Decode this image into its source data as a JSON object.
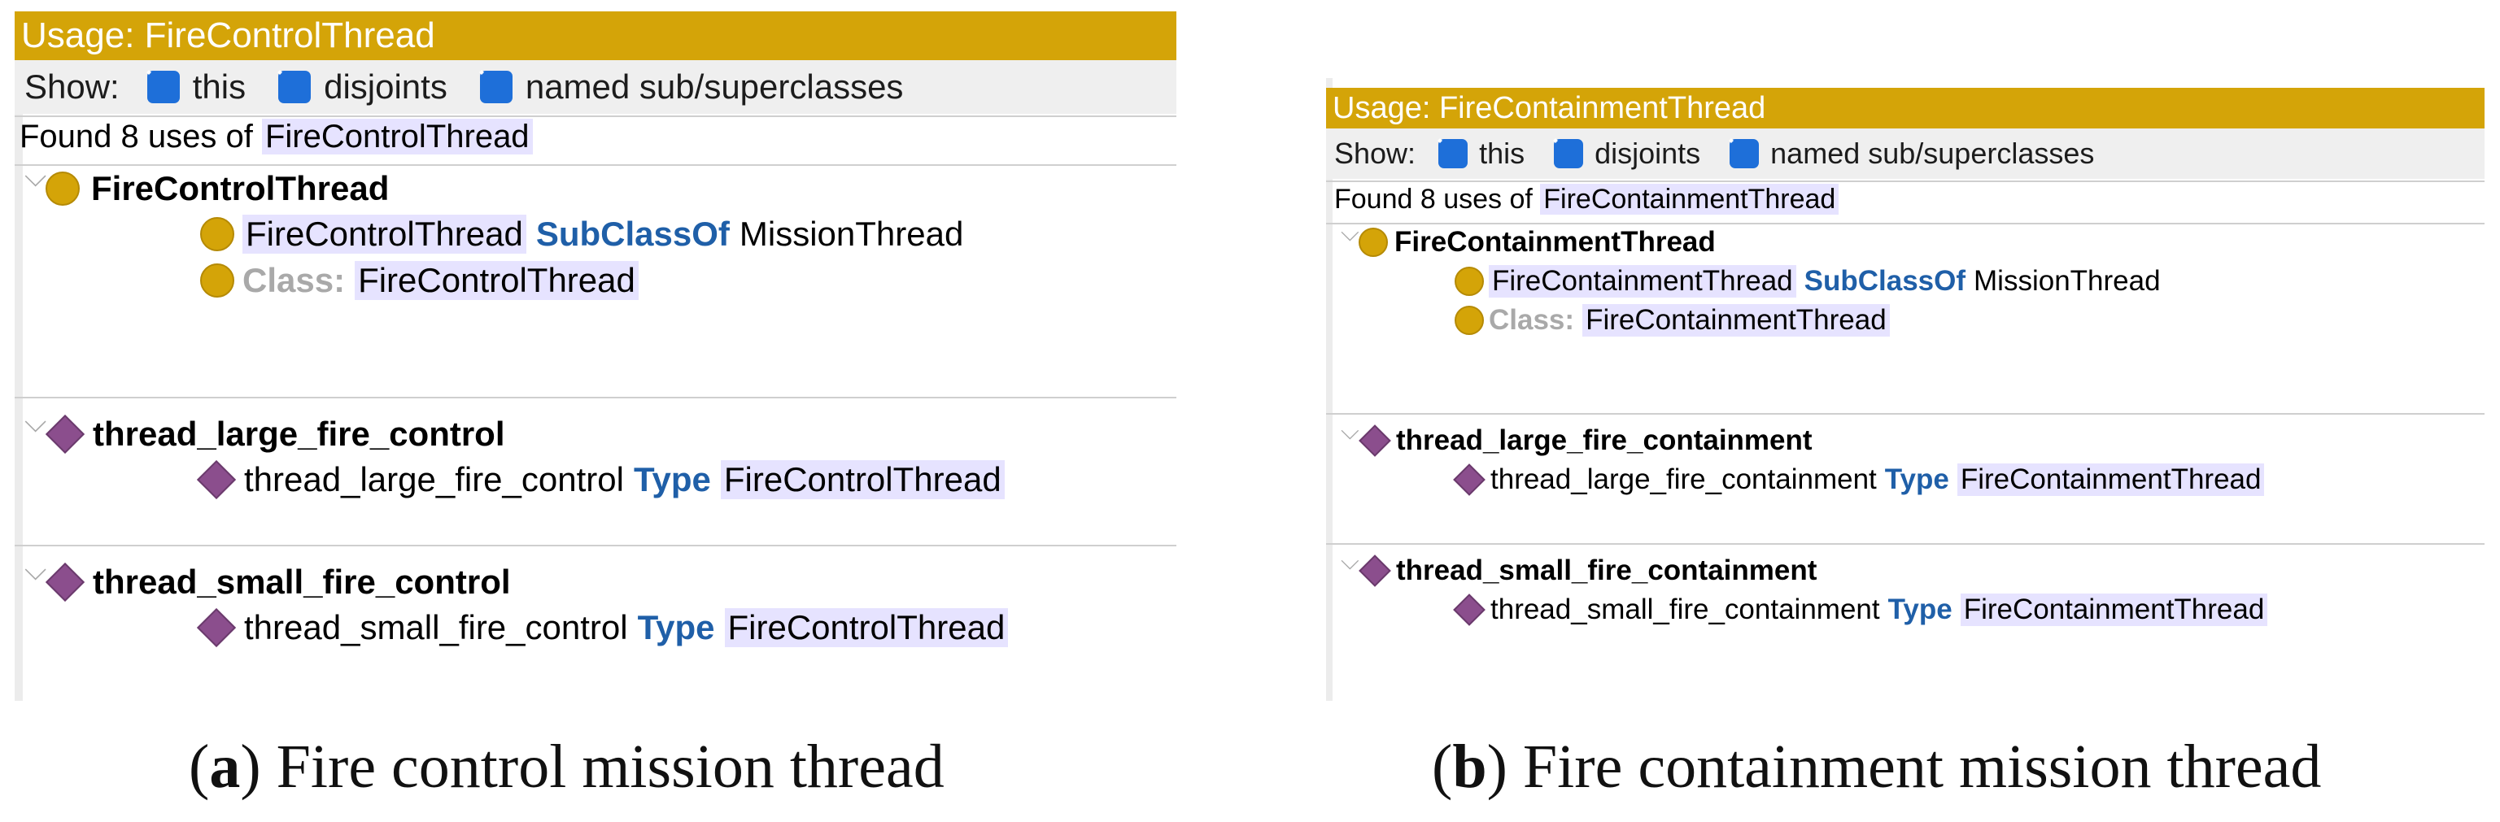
{
  "panels": [
    {
      "title": "Usage: FireControlThread",
      "show_label": "Show:",
      "checkboxes": [
        "this",
        "disjoints",
        "named sub/superclasses"
      ],
      "found_prefix": "Found 8 uses of",
      "found_class": "FireControlThread",
      "groups": [
        {
          "head": "FireControlThread",
          "head_icon": "class-circle-icon",
          "children": [
            {
              "a": "FireControlThread",
              "kw": "SubClassOf",
              "b": "MissionThread"
            },
            {
              "gray": "Class:",
              "c": "FireControlThread"
            }
          ]
        },
        {
          "head": "thread_large_fire_control",
          "head_icon": "individual-diamond-icon",
          "children": [
            {
              "a": "thread_large_fire_control",
              "kw": "Type",
              "c": "FireControlThread"
            }
          ]
        },
        {
          "head": "thread_small_fire_control",
          "head_icon": "individual-diamond-icon",
          "children": [
            {
              "a": "thread_small_fire_control",
              "kw": "Type",
              "c": "FireControlThread"
            }
          ]
        }
      ],
      "caption_letter": "a",
      "caption_text": "Fire control mission thread"
    },
    {
      "title": "Usage: FireContainmentThread",
      "show_label": "Show:",
      "checkboxes": [
        "this",
        "disjoints",
        "named sub/superclasses"
      ],
      "found_prefix": "Found 8 uses of",
      "found_class": "FireContainmentThread",
      "groups": [
        {
          "head": "FireContainmentThread",
          "head_icon": "class-circle-icon",
          "children": [
            {
              "a": "FireContainmentThread",
              "kw": "SubClassOf",
              "b": "MissionThread"
            },
            {
              "gray": "Class:",
              "c": "FireContainmentThread"
            }
          ]
        },
        {
          "head": "thread_large_fire_containment",
          "head_icon": "individual-diamond-icon",
          "children": [
            {
              "a": "thread_large_fire_containment",
              "kw": "Type",
              "c": "FireContainmentThread"
            }
          ]
        },
        {
          "head": "thread_small_fire_containment",
          "head_icon": "individual-diamond-icon",
          "children": [
            {
              "a": "thread_small_fire_containment",
              "kw": "Type",
              "c": "FireContainmentThread"
            }
          ]
        }
      ],
      "caption_letter": "b",
      "caption_text": "Fire containment mission thread"
    }
  ],
  "colors": {
    "title_bar": "#d4a408",
    "checkbox": "#1e6fd9",
    "keyword": "#1f5fa8",
    "class_icon": "#d4a408",
    "individual_icon": "#8b4e8d",
    "highlight": "#e6e3ff"
  }
}
